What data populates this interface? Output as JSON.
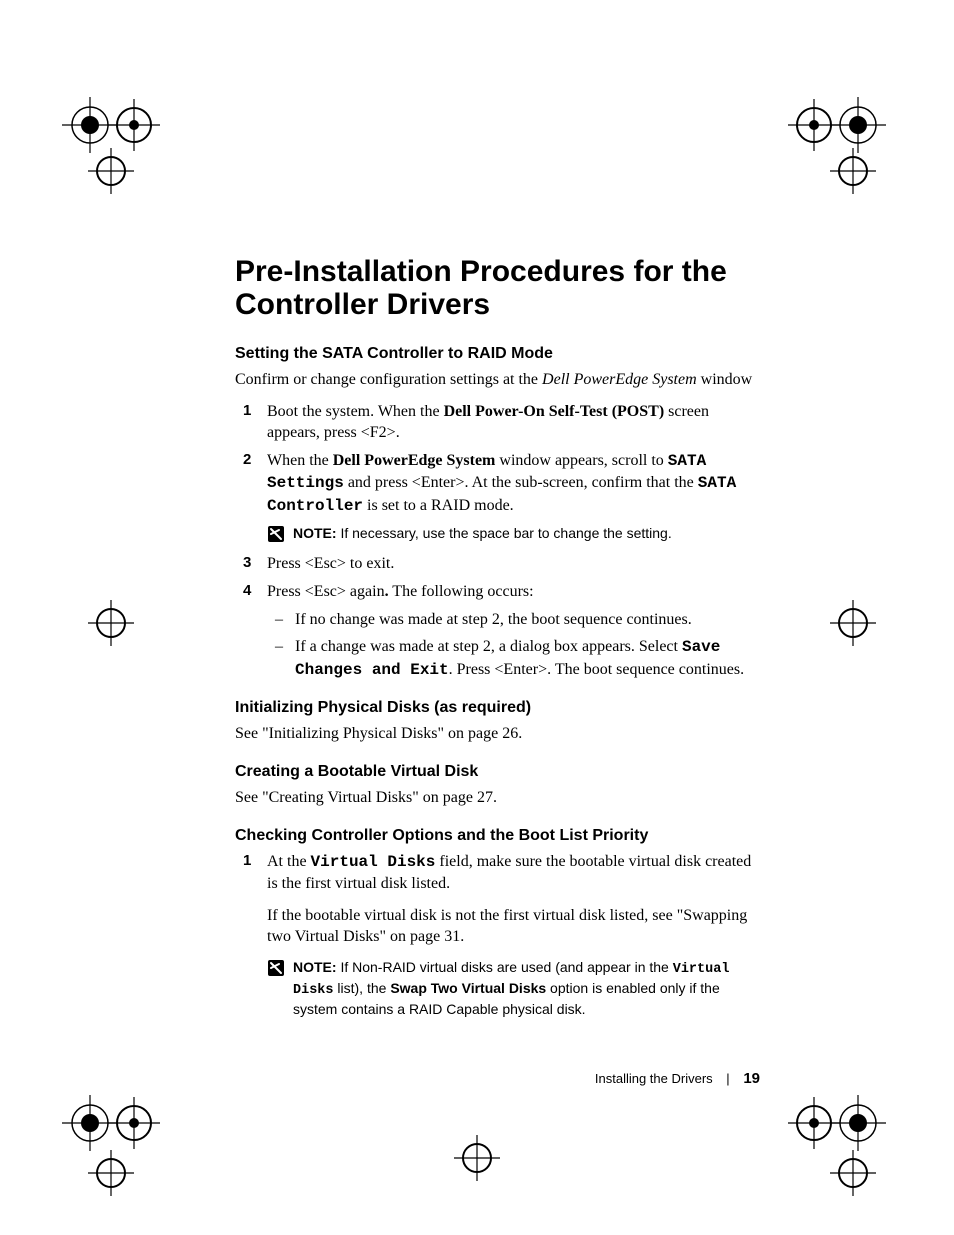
{
  "title": "Pre-Installation Procedures for the Controller Drivers",
  "section1": {
    "heading": "Setting the SATA Controller to RAID Mode",
    "intro_pre": "Confirm or change configuration settings at the ",
    "intro_italic": "Dell PowerEdge System",
    "intro_post": " window",
    "step1_pre": "Boot the system. When the ",
    "step1_bold": "Dell Power-On Self-Test (POST)",
    "step1_post": " screen appears, press <F2>.",
    "step2_pre": "When the ",
    "step2_bold1": "Dell PowerEdge System",
    "step2_mid1": " window appears, scroll to ",
    "step2_mono1": "SATA Settings",
    "step2_mid2": " and press <Enter>. At the sub-screen, confirm that the ",
    "step2_mono2": "SATA Controller",
    "step2_post": " is set to a RAID mode.",
    "note1_label": "NOTE:",
    "note1_text": " If necessary, use the space bar to change the setting.",
    "step3": "Press <Esc> to exit.",
    "step4_pre": "Press <Esc> again",
    "step4_dot": ".",
    "step4_post": " The following occurs:",
    "bullet1": "If no change was made at step 2, the boot sequence continues.",
    "bullet2_pre": "If a change was made at step 2, a dialog box appears. Select ",
    "bullet2_mono": "Save Changes and Exit",
    "bullet2_post": ". Press <Enter>. The boot sequence continues."
  },
  "section2": {
    "heading": "Initializing Physical Disks (as required)",
    "body": "See \"Initializing Physical Disks\" on page 26."
  },
  "section3": {
    "heading": "Creating a Bootable Virtual Disk",
    "body": "See \"Creating Virtual Disks\" on page 27."
  },
  "section4": {
    "heading": "Checking Controller Options and the Boot List Priority",
    "step1_pre": "At the ",
    "step1_mono": "Virtual Disks",
    "step1_post": " field, make sure the bootable virtual disk created is the first virtual disk listed.",
    "para2": "If the bootable virtual disk is not the first virtual disk listed, see \"Swapping two Virtual Disks\" on page 31.",
    "note_label": "NOTE:",
    "note_pre": " If Non-RAID virtual disks are used (and appear in the ",
    "note_mono1": "Virtual Disks",
    "note_mid": " list), the ",
    "note_bold": "Swap Two Virtual Disks",
    "note_post": " option is enabled only if the system contains a RAID Capable physical disk."
  },
  "footer": {
    "section": "Installing the Drivers",
    "sep": "|",
    "page": "19"
  }
}
